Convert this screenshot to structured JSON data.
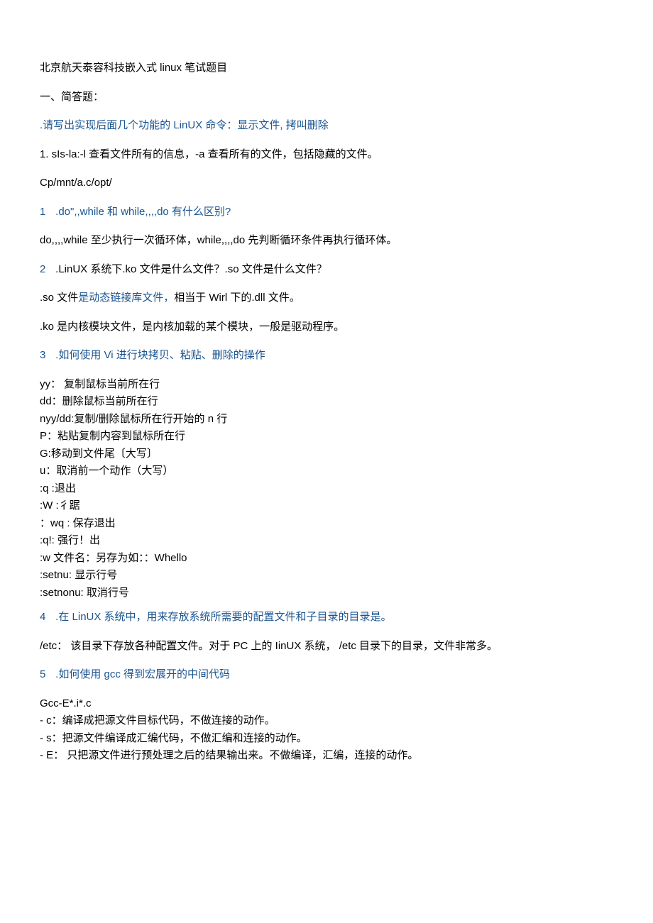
{
  "title": "北京航天泰容科技嵌入式 linux 笔试题目",
  "sectionHead": "一、简答题：",
  "q0": {
    "text_a": ".请写出实现后面几个功能的 ",
    "text_b": "LinUX",
    "text_c": " 命令：显示文件, 拷叫删除"
  },
  "a0_1": "1. sIs-la:-l 查看文件所有的信息，-a 查看所有的文件，包括隐藏的文件。",
  "a0_2": "Cp/mnt/a.c/opt/",
  "q1": {
    "num": "1",
    "a": "  .do\",,while ",
    "b": "和",
    "c": " while,,,,do ",
    "d": "有什么区别?"
  },
  "a1": "do,,,,while 至少执行一次循环体，while,,,,do 先判断循环条件再执行循环体。",
  "q2": {
    "num": "2",
    "text": "  .LinUX 系统下.ko 文件是什么文件？.so 文件是什么文件？"
  },
  "a2_1_a": ".so 文件",
  "a2_1_b": "是动态链接库文件，",
  "a2_1_c": "相当于 Wirl 下的.dll 文件。",
  "a2_2": ".ko 是内核模块文件，是内核加载的某个模块，一般是驱动程序。",
  "q3": {
    "num": "3",
    "a": "  .如何使用 ",
    "b": "Vi",
    "c": " 进行块拷贝、粘贴、删除的操作"
  },
  "vi": [
    "yy： 复制鼠标当前所在行",
    "dd：删除鼠标当前所在行",
    "nyy/dd:复制/删除鼠标所在行开始的 n 行",
    "P：粘贴复制内容到鼠标所在行",
    "G:移动到文件尾〔大写〕",
    "u：取消前一个动作（大写）",
    ":q          :退出",
    ":W         :彳踞",
    "：wq    : 保存退出",
    ":q!: 强行！出",
    ":w 文件名：另存为如：：Whello",
    ":setnu: 显示行号",
    ":setnonu: 取消行号"
  ],
  "q4": {
    "num": "4",
    "a": "  .在 ",
    "b": "LinUX",
    "c": " 系统中，用来存放系统所需要的配置文件和子目录的目录是。"
  },
  "a4": "/etc： 该目录下存放各种配置文件。对于 PC 上的 IinUX 系统， /etc 目录下的目录，文件非常多。",
  "q5": {
    "num": "5",
    "a": "  .如何使用 ",
    "b": "gcc",
    "c": " 得到宏展开的中间代码"
  },
  "gcc_head": "Gcc-E*.i*.c",
  "gcc": [
    "-   c：编译成把源文件目标代码，不做连接的动作。",
    "-   s：把源文件编译成汇编代码，不做汇编和连接的动作。",
    "-   E： 只把源文件进行预处理之后的结果输出来。不做编译，汇编，连接的动作。"
  ]
}
